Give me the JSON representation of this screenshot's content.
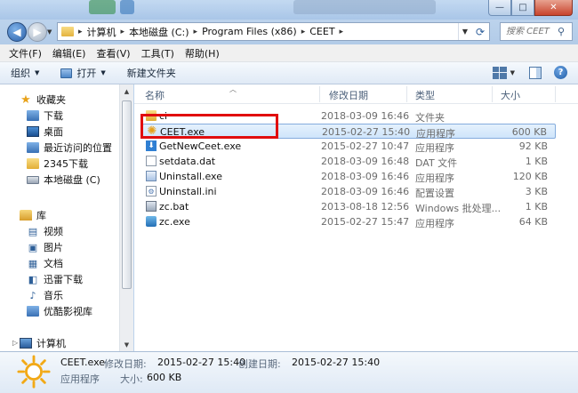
{
  "window": {
    "minimize_icon": "minimize-icon",
    "maximize_icon": "maximize-icon",
    "close_icon": "close-icon"
  },
  "address": {
    "crumbs": [
      "计算机",
      "本地磁盘 (C:)",
      "Program Files (x86)",
      "CEET"
    ],
    "search_placeholder": "搜索 CEET"
  },
  "menu": [
    "文件(F)",
    "编辑(E)",
    "查看(V)",
    "工具(T)",
    "帮助(H)"
  ],
  "toolbar": {
    "organize": "组织",
    "open": "打开",
    "new_folder": "新建文件夹"
  },
  "nav": {
    "favorites_header": "收藏夹",
    "favorites": [
      "下载",
      "桌面",
      "最近访问的位置",
      "2345下载",
      "本地磁盘 (C)"
    ],
    "libraries_header": "库",
    "libraries": [
      "视频",
      "图片",
      "文档",
      "迅雷下载",
      "音乐",
      "优酷影视库"
    ],
    "computer": "计算机"
  },
  "columns": {
    "name": "名称",
    "date": "修改日期",
    "type": "类型",
    "size": "大小"
  },
  "files": [
    {
      "name": "ci",
      "date": "2018-03-09 16:46",
      "type": "文件夹",
      "size": "",
      "icon": "folder-icon"
    },
    {
      "name": "CEET.exe",
      "date": "2015-02-27 15:40",
      "type": "应用程序",
      "size": "600 KB",
      "icon": "ceet-sun-icon"
    },
    {
      "name": "GetNewCeet.exe",
      "date": "2015-02-27 10:47",
      "type": "应用程序",
      "size": "92 KB",
      "icon": "download-arrow-icon"
    },
    {
      "name": "setdata.dat",
      "date": "2018-03-09 16:48",
      "type": "DAT 文件",
      "size": "1 KB",
      "icon": "document-icon"
    },
    {
      "name": "Uninstall.exe",
      "date": "2018-03-09 16:46",
      "type": "应用程序",
      "size": "120 KB",
      "icon": "uninstaller-icon"
    },
    {
      "name": "Uninstall.ini",
      "date": "2018-03-09 16:46",
      "type": "配置设置",
      "size": "3 KB",
      "icon": "ini-file-icon"
    },
    {
      "name": "zc.bat",
      "date": "2013-08-18 12:56",
      "type": "Windows 批处理...",
      "size": "1 KB",
      "icon": "batch-file-icon"
    },
    {
      "name": "zc.exe",
      "date": "2015-02-27 15:47",
      "type": "应用程序",
      "size": "64 KB",
      "icon": "zc-app-icon"
    }
  ],
  "details": {
    "filename": "CEET.exe",
    "modified_label": "修改日期:",
    "modified_value": "2015-02-27 15:40",
    "created_label": "创建日期:",
    "created_value": "2015-02-27 15:40",
    "type_value": "应用程序",
    "size_label": "大小:",
    "size_value": "600 KB"
  },
  "colors": {
    "highlight_box": "#e10d0d",
    "selection": "#cfe5fb"
  }
}
